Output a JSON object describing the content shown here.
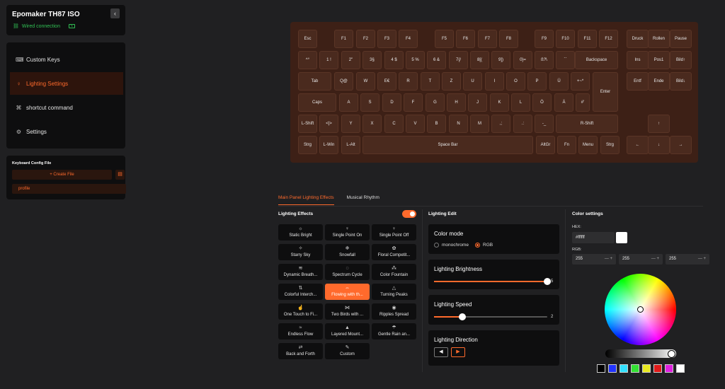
{
  "device": {
    "title": "Epomaker TH87 ISO",
    "connection": "Wired connection",
    "collapse_icon": "‹"
  },
  "nav": {
    "items": [
      {
        "label": "Custom Keys",
        "icon": "keyboard-icon",
        "glyph": "⌨"
      },
      {
        "label": "Lighting Settings",
        "icon": "bulb-icon",
        "glyph": "♀"
      },
      {
        "label": "shortcut command",
        "icon": "command-icon",
        "glyph": "⌘"
      },
      {
        "label": "Settings",
        "icon": "gear-icon",
        "glyph": "⚙"
      }
    ]
  },
  "config": {
    "header": "Keyboard Config File",
    "create_label": "+ Create File",
    "profile": "profile"
  },
  "keyboard": {
    "keys": [
      [
        "Esc",
        "F1",
        "F2",
        "F3",
        "F4",
        "F5",
        "F6",
        "F7",
        "F8",
        "F9",
        "F10",
        "F11",
        "F12",
        "Druck",
        "Rollen",
        "Pause"
      ],
      [
        "^°",
        "1 !",
        "2\"",
        "3§",
        "4 $",
        "5 %",
        "6 &",
        "7{/",
        "8[(",
        "9])",
        "0}=",
        "ß?\\",
        "´`",
        "Backspace",
        "Ins",
        "Pos1",
        "Bild↑"
      ],
      [
        "Tab",
        "Q@",
        "W",
        "E€",
        "R",
        "T",
        "Z",
        "U",
        "I",
        "O",
        "P",
        "Ü",
        "+~*",
        "Enter",
        "Entf",
        "Ende",
        "Bild↓"
      ],
      [
        "Caps",
        "A",
        "S",
        "D",
        "F",
        "G",
        "H",
        "J",
        "K",
        "L",
        "Ö",
        "Ä",
        "#'"
      ],
      [
        "L-Shift",
        "<|>",
        "Y",
        "X",
        "C",
        "V",
        "B",
        "N",
        "M",
        ",;",
        ".:",
        "-_",
        "R-Shift",
        "↑"
      ],
      [
        "Strg",
        "L-Win",
        "L-Alt",
        "Space Bar",
        "AltGr",
        "Fn",
        "Menu",
        "Strg",
        "←",
        "↓",
        "→"
      ]
    ]
  },
  "tabs": [
    "Main Panel Lighting Effects",
    "Musical Rhythm"
  ],
  "effects": {
    "header": "Lighting Effects",
    "toggle_on": true,
    "items": [
      {
        "label": "Static Bright",
        "icon": "sun-icon",
        "glyph": "☼"
      },
      {
        "label": "Single Point On",
        "icon": "bulb-icon",
        "glyph": "♀"
      },
      {
        "label": "Single Point Off",
        "icon": "bulb-off-icon",
        "glyph": "♀"
      },
      {
        "label": "Starry Sky",
        "icon": "stars-icon",
        "glyph": "✧"
      },
      {
        "label": "Snowfall",
        "icon": "snow-icon",
        "glyph": "❄"
      },
      {
        "label": "Floral Competit...",
        "icon": "flower-icon",
        "glyph": "✿"
      },
      {
        "label": "Dynamic Breath...",
        "icon": "wind-icon",
        "glyph": "≋"
      },
      {
        "label": "Spectrum Cycle",
        "icon": "cycle-icon",
        "glyph": "◌"
      },
      {
        "label": "Color Fountain",
        "icon": "fountain-icon",
        "glyph": "⁂"
      },
      {
        "label": "Colorful Interch...",
        "icon": "interchange-icon",
        "glyph": "⇅"
      },
      {
        "label": "Flowing with th...",
        "icon": "flow-icon",
        "glyph": "⇔"
      },
      {
        "label": "Turning Peaks",
        "icon": "peaks-icon",
        "glyph": "△"
      },
      {
        "label": "One Touch to Fi...",
        "icon": "touch-icon",
        "glyph": "☝"
      },
      {
        "label": "Two Birds with ...",
        "icon": "birds-icon",
        "glyph": "⋈"
      },
      {
        "label": "Ripples Spread",
        "icon": "ripples-icon",
        "glyph": "◉"
      },
      {
        "label": "Endless Flow",
        "icon": "wave-icon",
        "glyph": "≈"
      },
      {
        "label": "Layered Mount...",
        "icon": "mountain-icon",
        "glyph": "▲"
      },
      {
        "label": "Gentle Rain an...",
        "icon": "rain-icon",
        "glyph": "☂"
      },
      {
        "label": "Back and Forth",
        "icon": "swap-icon",
        "glyph": "⇄"
      },
      {
        "label": "Custom",
        "icon": "edit-icon",
        "glyph": "✎"
      }
    ]
  },
  "edit": {
    "header": "Lighting Edit",
    "color_mode": {
      "title": "Color mode",
      "options": [
        "monochrome",
        "RGB"
      ],
      "selected": "RGB"
    },
    "brightness": {
      "title": "Lighting Brightness",
      "value": "5",
      "fraction": 1.0
    },
    "speed": {
      "title": "Lighting Speed",
      "value": "2",
      "fraction": 0.25
    },
    "direction": {
      "title": "Lighting Direction",
      "left_glyph": "◀",
      "right_glyph": "▶",
      "selected": "right"
    }
  },
  "color": {
    "header": "Color settings",
    "hex_label": "HEX:",
    "hex_value": "#ffffff",
    "rgb_label": "RGB:",
    "rgb": [
      "255",
      "255",
      "255"
    ],
    "stepper": "— +",
    "swatches": [
      "#000000",
      "#2233ff",
      "#33e0ff",
      "#33e033",
      "#e8e820",
      "#e01a1a",
      "#e020e0",
      "#ffffff"
    ],
    "accent": "#ff6a2c"
  }
}
